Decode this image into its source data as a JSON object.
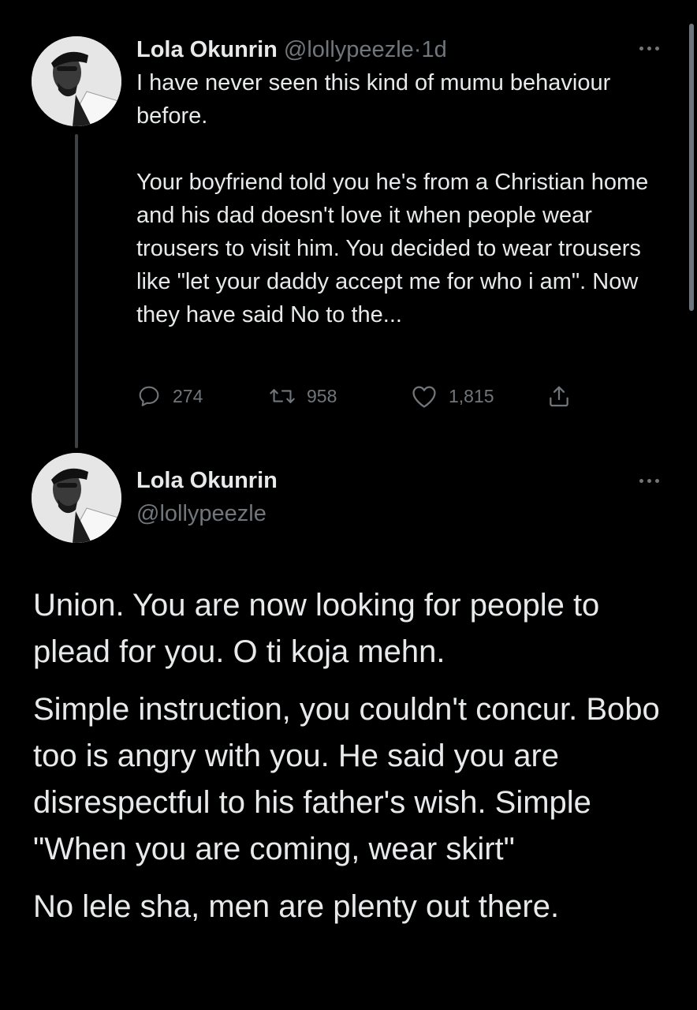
{
  "tweet1": {
    "name": "Lola Okunrin",
    "handle": "@lollypeezle",
    "separator": "·",
    "time": "1d",
    "paragraphs": [
      "I have never seen this kind of mumu behaviour before.",
      "Your boyfriend told you he's from a Christian home and his dad doesn't love it when people wear trousers to visit him. You decided to wear trousers like \"let your daddy accept me for who i am\". Now they have said No to the..."
    ],
    "replies": "274",
    "retweets": "958",
    "likes": "1,815",
    "icons": [
      "reply-icon",
      "retweet-icon",
      "like-icon",
      "share-icon",
      "more-icon"
    ]
  },
  "tweet2": {
    "name": "Lola Okunrin",
    "handle": "@lollypeezle",
    "paragraphs": [
      "Union. You are now looking for people to plead for you. O ti koja mehn.",
      "Simple instruction, you couldn't concur. Bobo too is angry with you. He said you are disrespectful to his father's wish. Simple \"When you are coming, wear skirt\"",
      "No lele sha, men are plenty out there."
    ]
  },
  "colors": {
    "background": "#000000",
    "text": "#e7e9ea",
    "secondary": "#71767b",
    "thread_line": "#3e4144"
  }
}
